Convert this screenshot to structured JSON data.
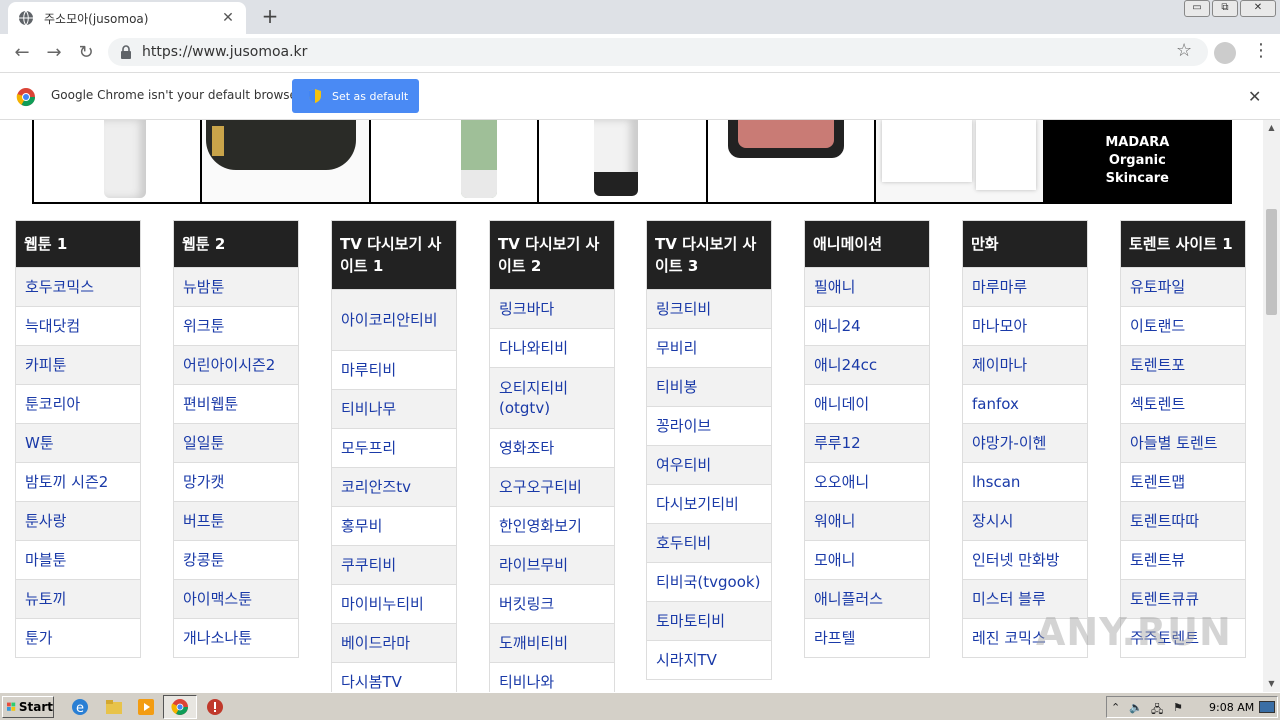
{
  "browser": {
    "tab_title": "주소모아(jusomoa)",
    "url": "https://www.jusomoa.kr",
    "window_controls": [
      "▭",
      "⧉",
      "✕"
    ]
  },
  "infobar": {
    "message": "Google Chrome isn't your default browser",
    "button_label": "Set as default"
  },
  "banner": {
    "brand_text": "MADARA\nOrganic\nSkincare"
  },
  "columns": [
    {
      "title": "웹툰 1",
      "items": [
        "호두코믹스",
        "늑대닷컴",
        "카피툰",
        "툰코리아",
        "W툰",
        "밤토끼 시즌2",
        "툰사랑",
        "마블툰",
        "뉴토끼",
        "툰가"
      ]
    },
    {
      "title": "웹툰 2",
      "items": [
        "뉴밤툰",
        "위크툰",
        "어린아이시즌2",
        "편비웹툰",
        "일일툰",
        "망가캣",
        "버프툰",
        "캉콩툰",
        "아이맥스툰",
        "개나소나툰"
      ]
    },
    {
      "title": "TV 다시보기 사이트 1",
      "items": [
        "아이코리안티비",
        "마루티비",
        "티비나무",
        "모두프리",
        "코리안즈tv",
        "홍무비",
        "쿠쿠티비",
        "마이비누티비",
        "베이드라마",
        "다시봄TV"
      ]
    },
    {
      "title": "TV 다시보기 사이트 2",
      "items": [
        "링크바다",
        "다나와티비",
        "오티지티비(otgtv)",
        "영화조타",
        "오구오구티비",
        "한인영화보기",
        "라이브무비",
        "버킷링크",
        "도깨비티비",
        "티비나와"
      ]
    },
    {
      "title": "TV 다시보기 사이트 3",
      "items": [
        "링크티비",
        "무비리",
        "티비봉",
        "꽁라이브",
        "여우티비",
        "다시보기티비",
        "호두티비",
        "티비국(tvgook)",
        "토마토티비",
        "시라지TV"
      ]
    },
    {
      "title": "애니메이션",
      "items": [
        "필애니",
        "애니24",
        "애니24cc",
        "애니데이",
        "루루12",
        "오오애니",
        "워애니",
        "모애니",
        "애니플러스",
        "라프텔"
      ]
    },
    {
      "title": "만화",
      "items": [
        "마루마루",
        "마나모아",
        "제이마나",
        "fanfox",
        "야망가-이헨",
        "lhscan",
        "장시시",
        "인터넷 만화방",
        "미스터 블루",
        "레진 코믹스"
      ]
    },
    {
      "title": "토렌트 사이트 1",
      "items": [
        "유토파일",
        "이토랜드",
        "토렌트포",
        "섹토렌트",
        "아들별 토렌트",
        "토렌트맵",
        "토렌트따따",
        "토렌트뷰",
        "토렌트큐큐",
        "주주토렌트"
      ]
    }
  ],
  "watermark": "ANY.RUN",
  "taskbar": {
    "start_label": "Start",
    "clock": "9:08 AM"
  }
}
